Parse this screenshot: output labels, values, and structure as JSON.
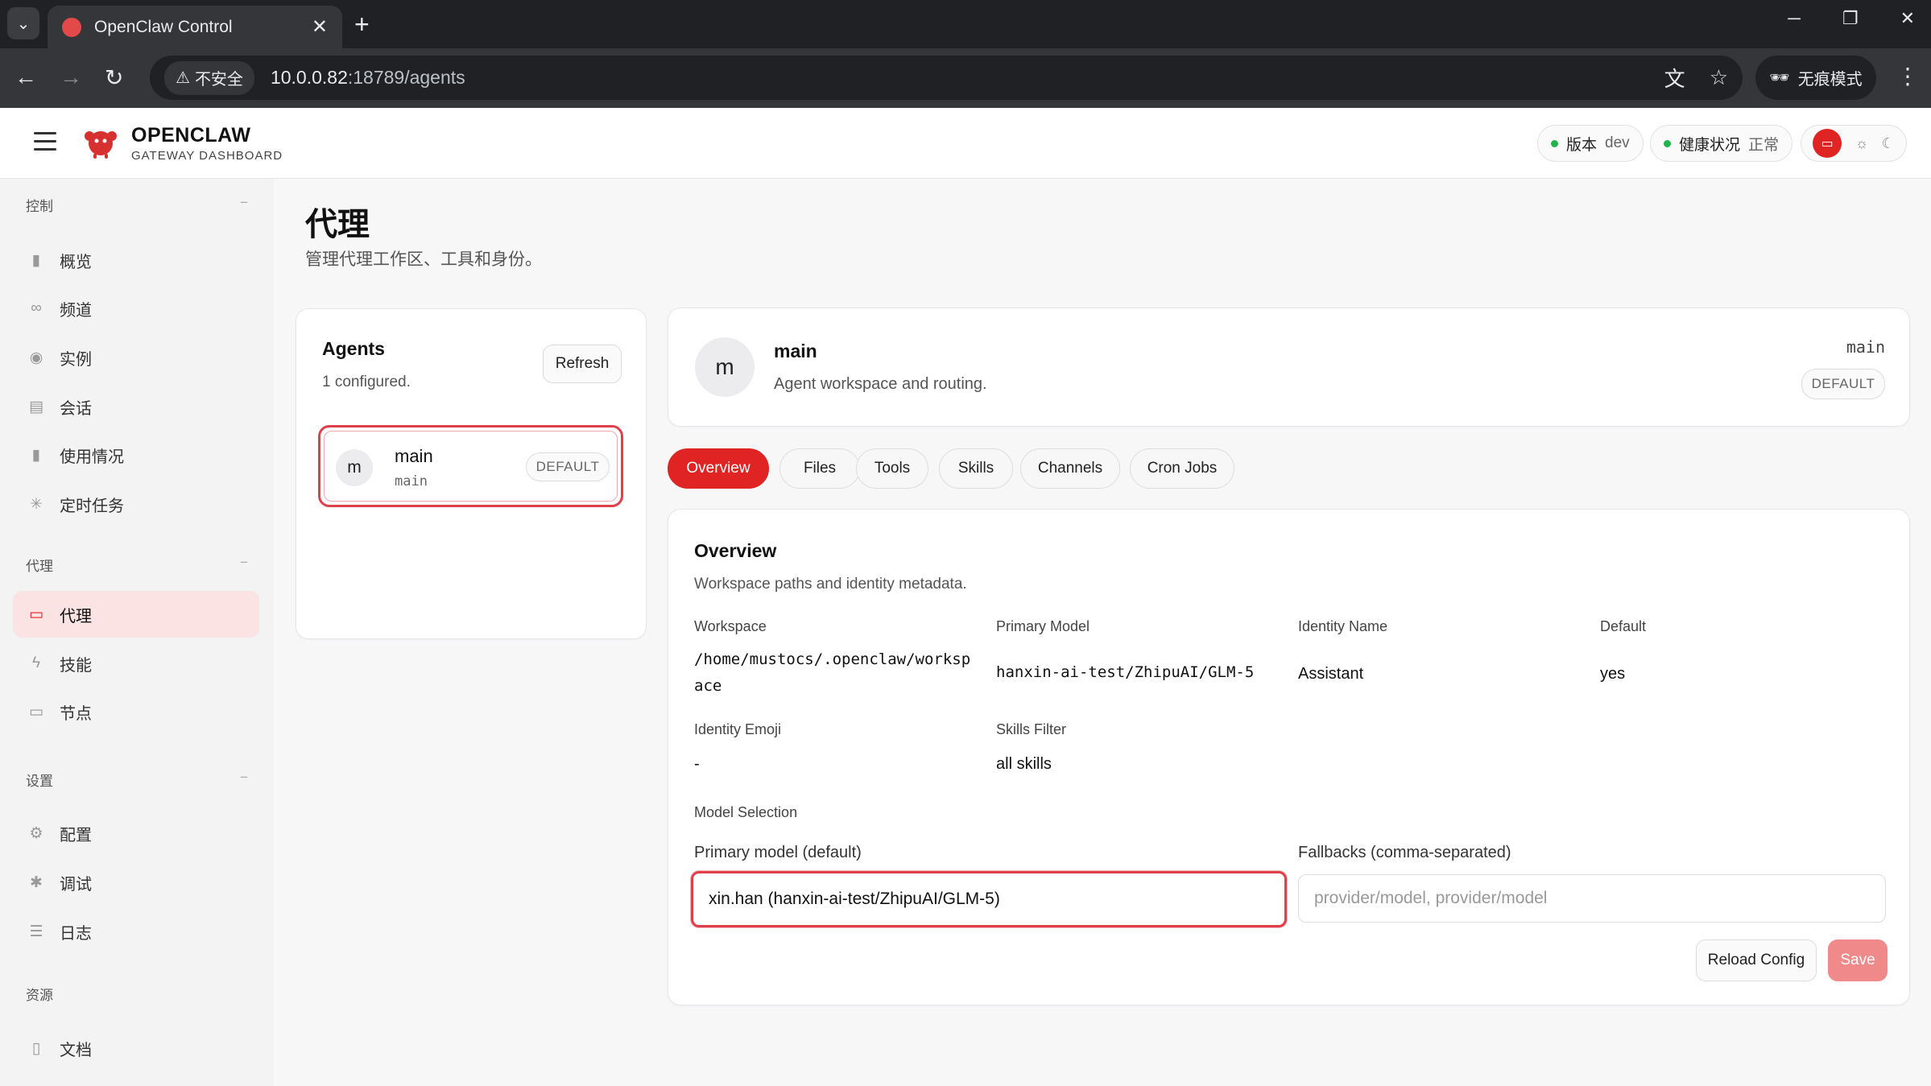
{
  "browser": {
    "tab_title": "OpenClaw Control",
    "insecure_label": "不安全",
    "url_host": "10.0.0.82",
    "url_path": ":18789/agents",
    "incognito_label": "无痕模式"
  },
  "header": {
    "brand_name": "OPENCLAW",
    "brand_sub": "GATEWAY DASHBOARD",
    "version_label": "版本",
    "version_value": "dev",
    "health_label": "健康状况",
    "health_value": "正常"
  },
  "sidebar": {
    "sections": [
      {
        "title": "控制",
        "items": [
          "概览",
          "频道",
          "实例",
          "会话",
          "使用情况",
          "定时任务"
        ]
      },
      {
        "title": "代理",
        "items": [
          "代理",
          "技能",
          "节点"
        ]
      },
      {
        "title": "设置",
        "items": [
          "配置",
          "调试",
          "日志"
        ]
      },
      {
        "title": "资源",
        "items": [
          "文档"
        ]
      }
    ],
    "active_item": "代理"
  },
  "page": {
    "title": "代理",
    "subtitle": "管理代理工作区、工具和身份。"
  },
  "agents_panel": {
    "title": "Agents",
    "count": "1 configured.",
    "refresh_label": "Refresh",
    "agents": [
      {
        "avatar": "m",
        "name": "main",
        "id": "main",
        "badge": "DEFAULT"
      }
    ]
  },
  "agent_header": {
    "avatar": "m",
    "name": "main",
    "subtitle": "Agent workspace and routing.",
    "id": "main",
    "badge": "DEFAULT"
  },
  "tabs": [
    "Overview",
    "Files",
    "Tools",
    "Skills",
    "Channels",
    "Cron Jobs"
  ],
  "active_tab": "Overview",
  "overview": {
    "title": "Overview",
    "subtitle": "Workspace paths and identity metadata.",
    "workspace_label": "Workspace",
    "workspace_value_1": "/home/mustocs/.openclaw/worksp",
    "workspace_value_2": "ace",
    "primary_model_label": "Primary Model",
    "primary_model_value": "hanxin-ai-test/ZhipuAI/GLM-5",
    "identity_name_label": "Identity Name",
    "identity_name_value": "Assistant",
    "default_label": "Default",
    "default_value": "yes",
    "identity_emoji_label": "Identity Emoji",
    "identity_emoji_value": "-",
    "skills_filter_label": "Skills Filter",
    "skills_filter_value": "all skills",
    "model_selection_label": "Model Selection",
    "primary_input_label": "Primary model (default)",
    "primary_input_value": "xin.han (hanxin-ai-test/ZhipuAI/GLM-5)",
    "fallbacks_label": "Fallbacks (comma-separated)",
    "fallbacks_placeholder": "provider/model, provider/model",
    "reload_label": "Reload Config",
    "save_label": "Save"
  },
  "colors": {
    "accent": "#e02424",
    "accent_light": "#fbe3e3",
    "status_ok": "#22b34a"
  }
}
